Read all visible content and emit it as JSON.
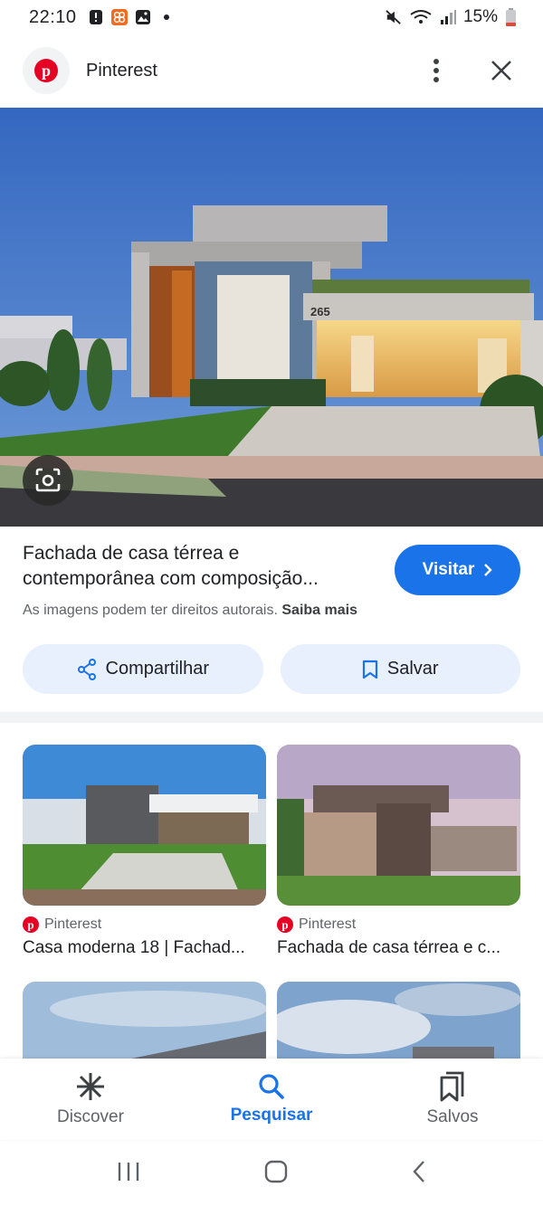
{
  "status_bar": {
    "time": "22:10",
    "battery": "15%"
  },
  "header": {
    "site_name": "Pinterest",
    "brand_color": "#e60023"
  },
  "result": {
    "title": "Fachada de casa térrea e contemporânea com composição...",
    "visit_label": "Visitar",
    "copyright_text": "As imagens podem ter direitos autorais.",
    "learn_more": "Saiba mais"
  },
  "actions": {
    "share_label": "Compartilhar",
    "save_label": "Salvar"
  },
  "related": [
    {
      "source": "Pinterest",
      "title": "Casa moderna 18 | Fachad..."
    },
    {
      "source": "Pinterest",
      "title": "Fachada de casa térrea e c..."
    }
  ],
  "bottom_nav": {
    "items": [
      {
        "label": "Discover",
        "icon": "asterisk-icon"
      },
      {
        "label": "Pesquisar",
        "icon": "search-icon"
      },
      {
        "label": "Salvos",
        "icon": "bookmarks-icon"
      }
    ],
    "active_index": 1
  },
  "colors": {
    "accent": "#1a73e8",
    "pill_bg": "#e8f0fe"
  }
}
